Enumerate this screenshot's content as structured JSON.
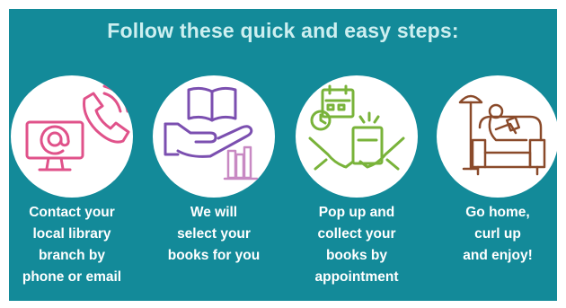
{
  "title": "Follow these quick and easy steps:",
  "steps": [
    {
      "caption": "Contact your\nlocal library\nbranch by\nphone or email",
      "icon": "phone-and-email-icon",
      "color": "#e0528a"
    },
    {
      "caption": "We will\nselect your\nbooks for you",
      "icon": "hand-with-books-icon",
      "color": "#7b4fb0"
    },
    {
      "caption": "Pop up and\ncollect your\nbooks by\nappointment",
      "icon": "book-pickup-calendar-icon",
      "color": "#79b33a"
    },
    {
      "caption": "Go home,\ncurl up\nand enjoy!",
      "icon": "reading-on-sofa-icon",
      "color": "#8a4a2a"
    }
  ],
  "colors": {
    "background": "#138a99",
    "title": "#cdeff0",
    "caption": "#ffffff",
    "circle": "#ffffff"
  }
}
